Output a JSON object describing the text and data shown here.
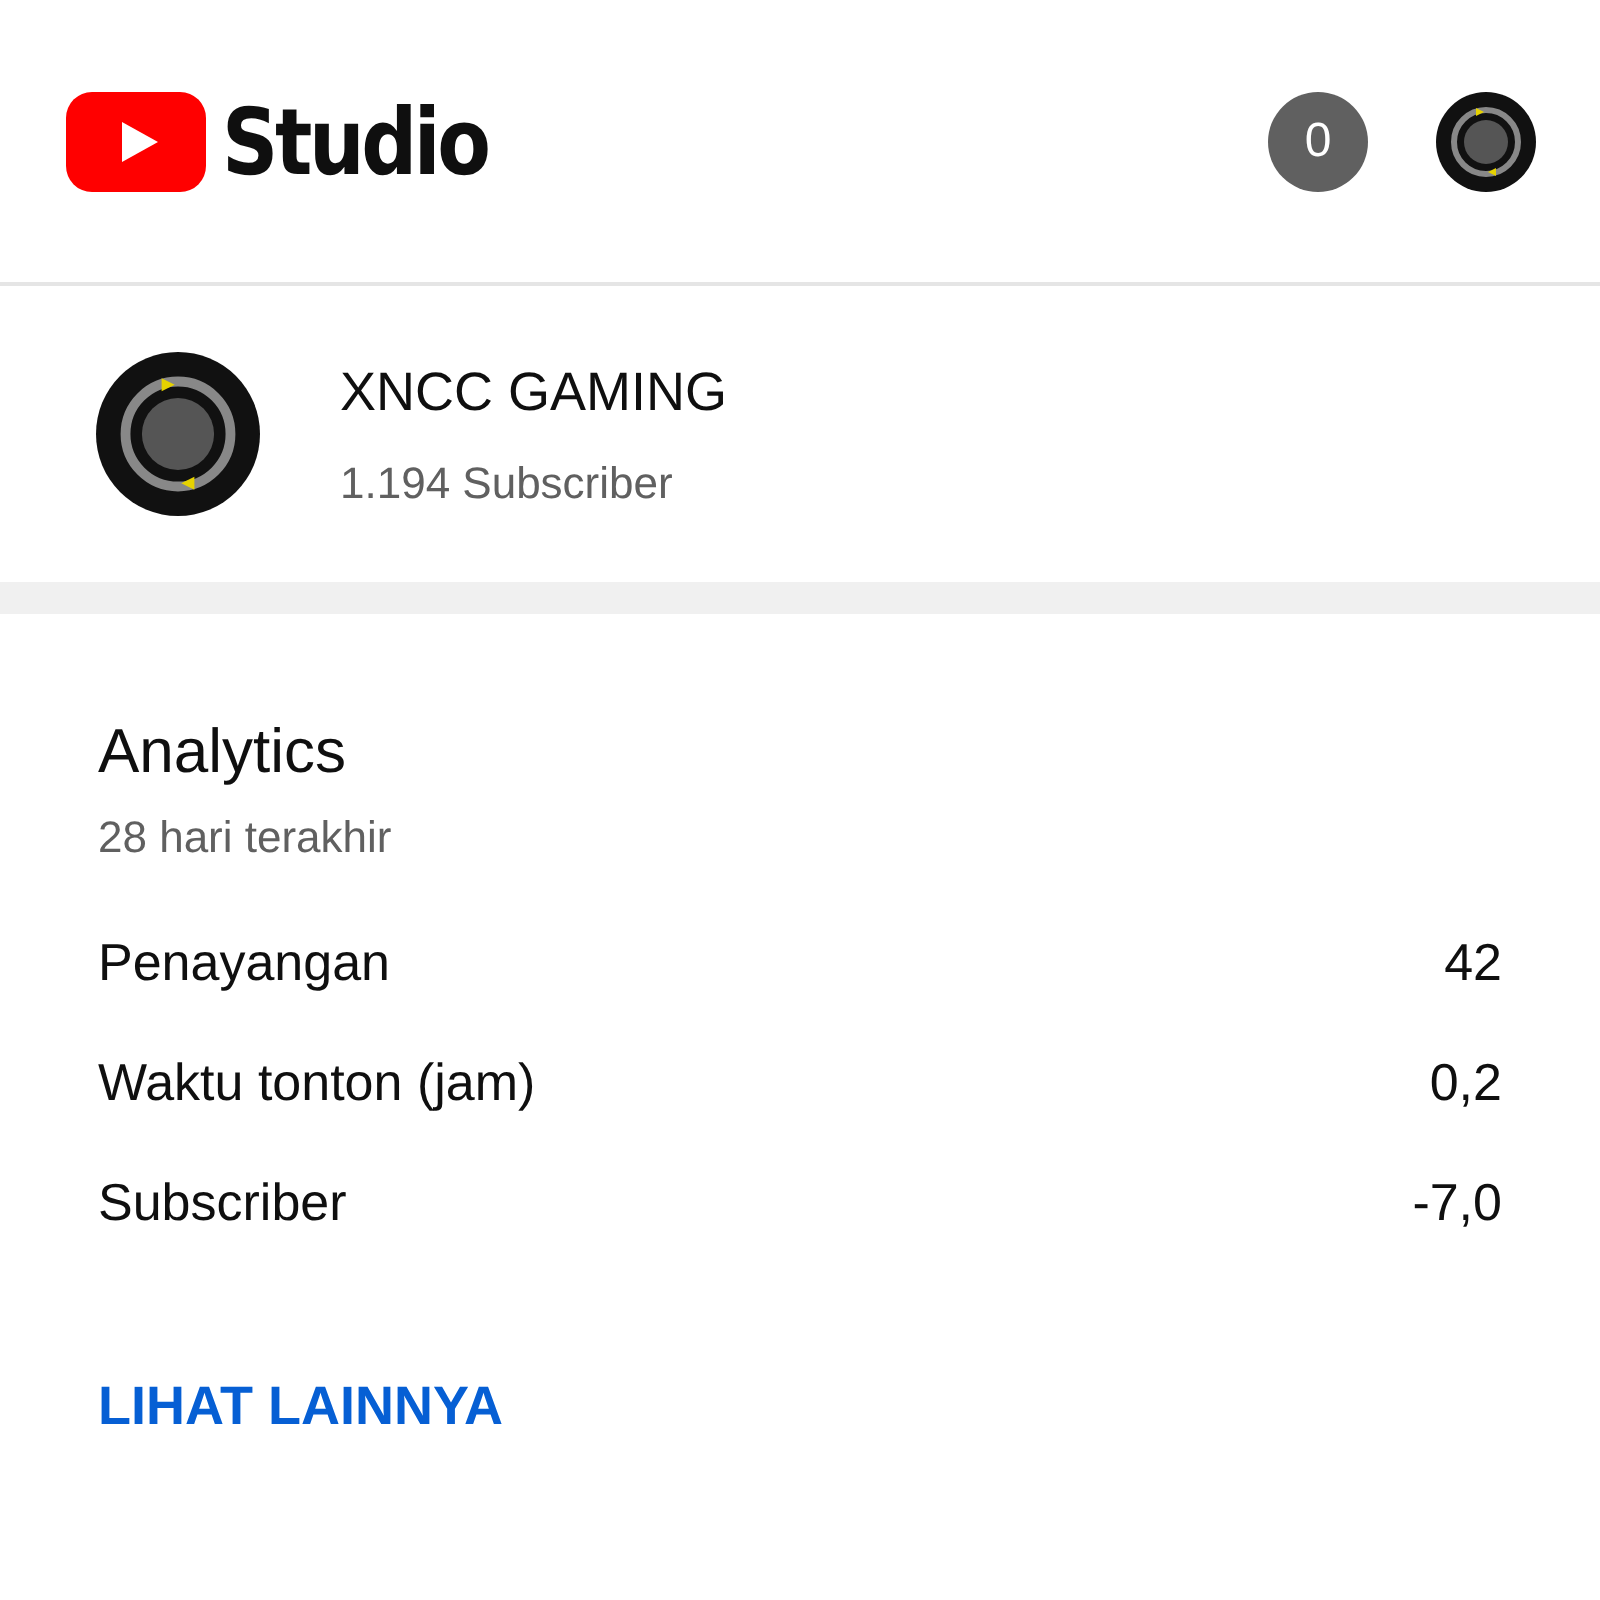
{
  "header": {
    "logo_text": "Studio",
    "notification_count": "0"
  },
  "channel": {
    "name": "XNCC GAMING",
    "subscribers": "1.194 Subscriber"
  },
  "analytics": {
    "title": "Analytics",
    "period": "28 hari terakhir",
    "metrics": [
      {
        "label": "Penayangan",
        "value": "42"
      },
      {
        "label": "Waktu tonton (jam)",
        "value": "0,2"
      },
      {
        "label": "Subscriber",
        "value": "-7,0"
      }
    ],
    "link": "LIHAT LAINNYA"
  }
}
